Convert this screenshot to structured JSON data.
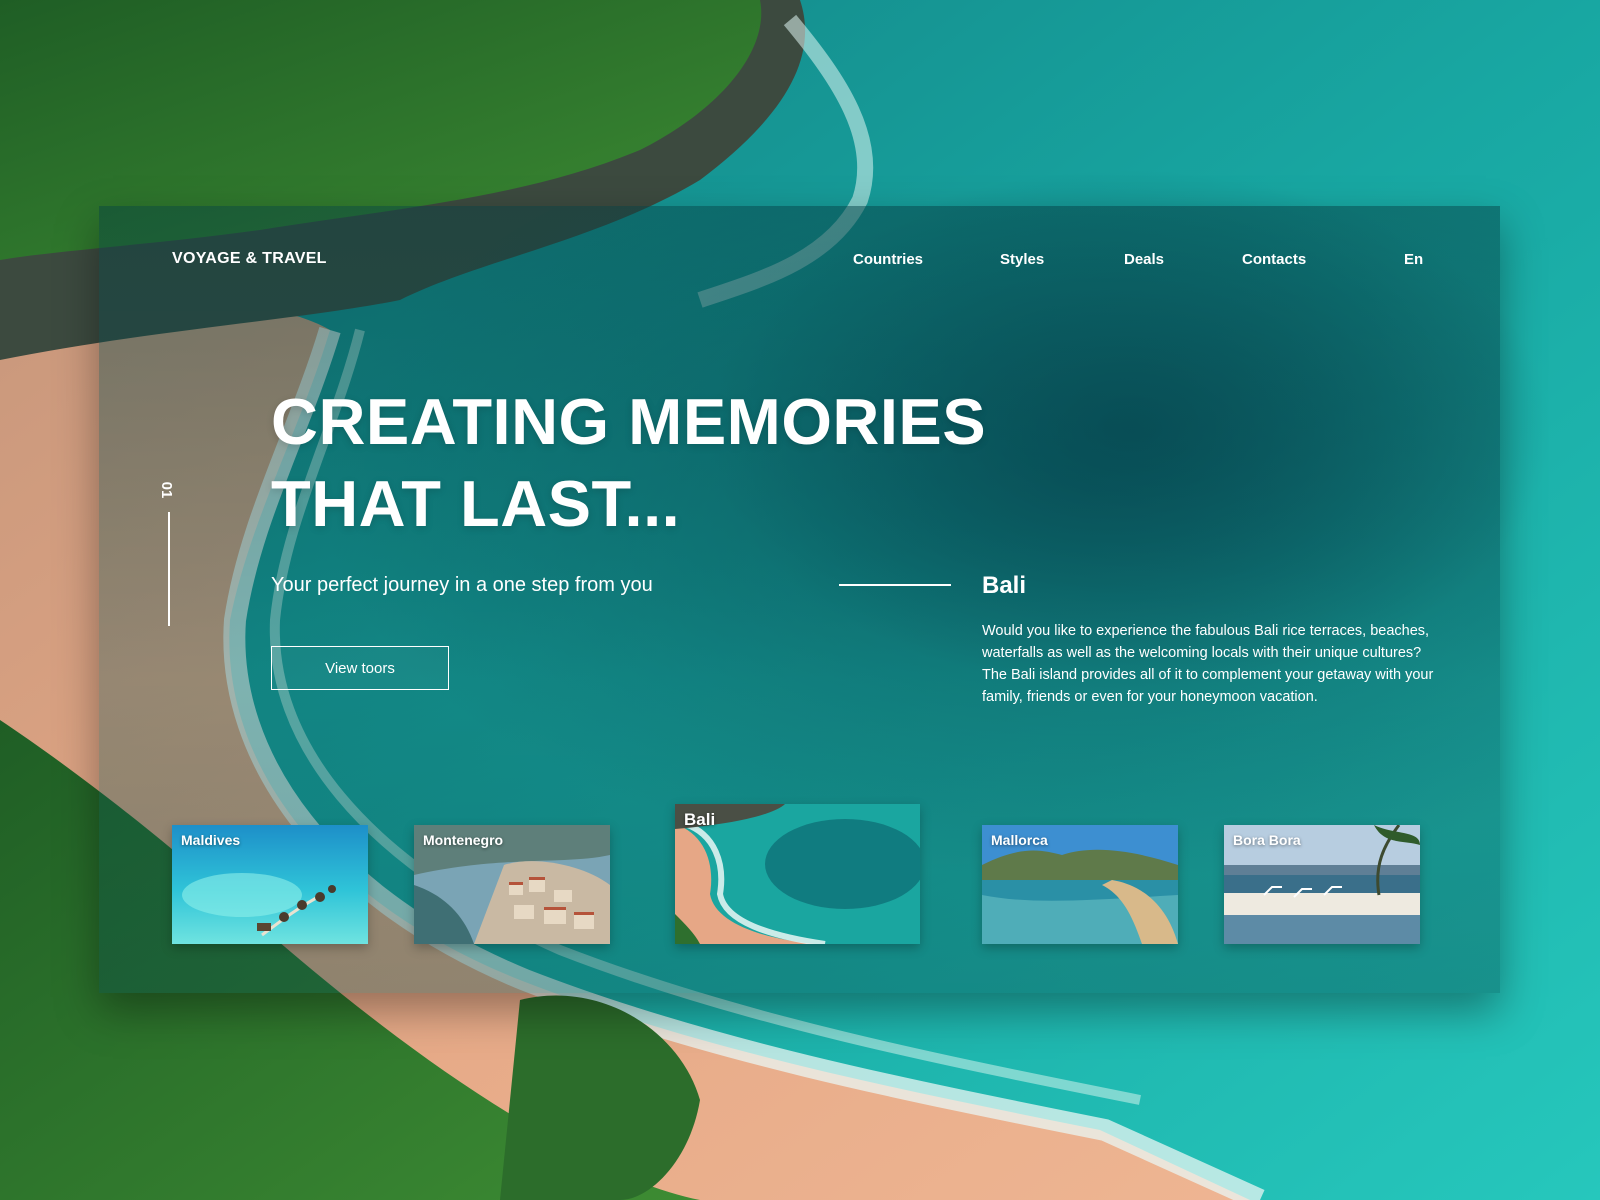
{
  "brand": "VOYAGE & TRAVEL",
  "nav": {
    "items": [
      "Countries",
      "Styles",
      "Deals",
      "Contacts"
    ],
    "language": "En"
  },
  "slide": {
    "number": "01"
  },
  "hero": {
    "title_line1": "CREATING MEMORIES",
    "title_line2": "THAT LAST...",
    "subtitle": "Your perfect journey in a one step from you",
    "cta_label": "View toors"
  },
  "featured": {
    "title": "Bali",
    "description": "Would you like to experience the fabulous Bali rice terraces, beaches, waterfalls as well as the welcoming locals with their unique cultures? The Bali island provides all of it to complement your getaway with your family, friends or even for your honeymoon vacation."
  },
  "destinations": [
    {
      "label": "Maldives"
    },
    {
      "label": "Montenegro"
    },
    {
      "label": "Bali",
      "active": true
    },
    {
      "label": "Mallorca"
    },
    {
      "label": "Bora Bora"
    }
  ],
  "colors": {
    "sea": "#1fb5ad",
    "deep_sea": "#0e6f73",
    "sand": "#e8a883",
    "foliage": "#2f7a32",
    "text": "#ffffff"
  }
}
